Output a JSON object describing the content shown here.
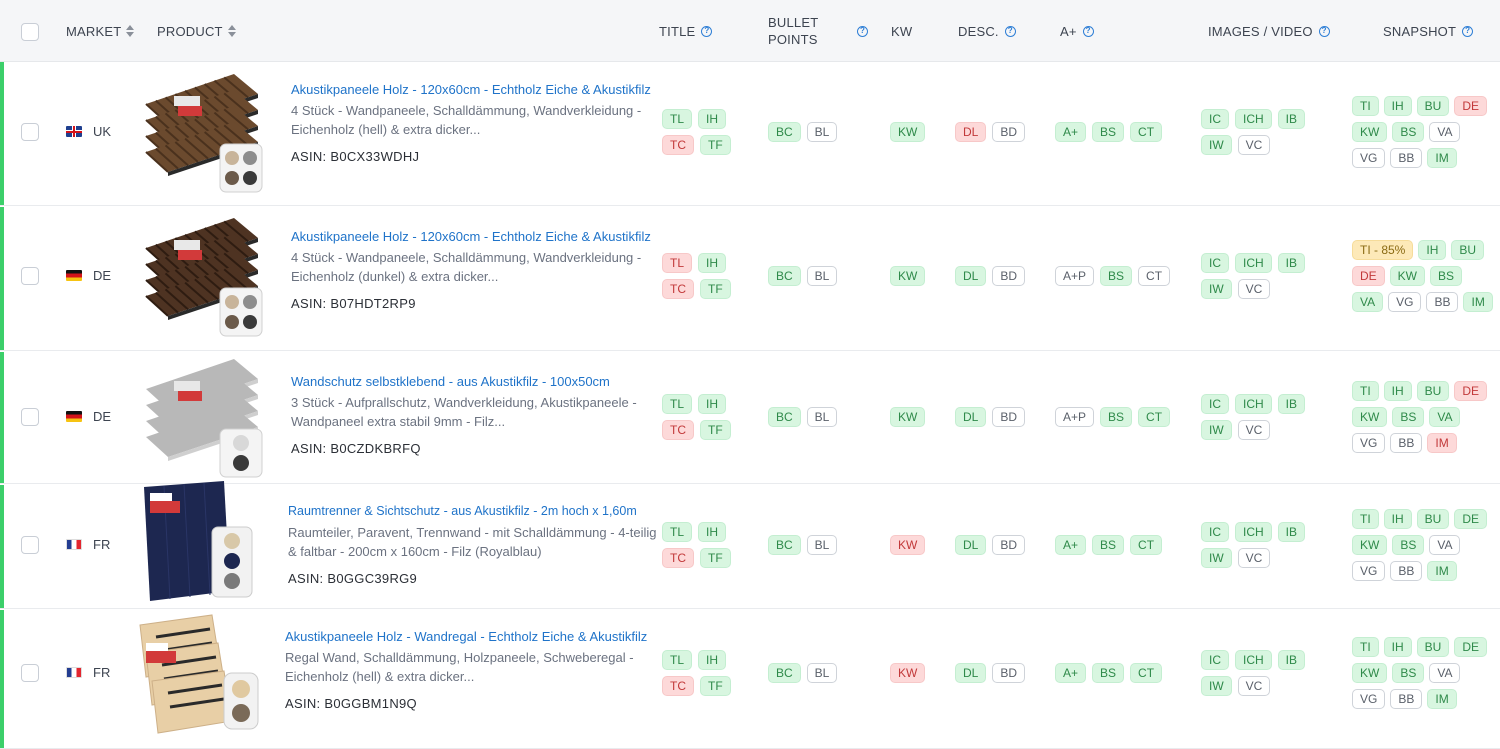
{
  "header": {
    "market": "MARKET",
    "product": "PRODUCT",
    "title": "TITLE",
    "bullet_line1": "BULLET",
    "bullet_line2": "POINTS",
    "kw": "KW",
    "desc": "DESC.",
    "aplus": "A+",
    "images": "IMAGES / VIDEO",
    "snapshot": "SNAPSHOT",
    "help_glyph": "?"
  },
  "rows": [
    {
      "market": "UK",
      "flag": "uk",
      "title": "Akustikpaneele Holz - 120x60cm - Echtholz Eiche & Akustikfilz",
      "description": "4 Stück - Wandpaneele, Schalldämmung, Wandverkleidung - Eichenholz (hell) & extra dicker...",
      "asin": "ASIN: B0CX33WDHJ",
      "image_style": "oak-light",
      "title_tags": [
        {
          "l": "TL",
          "s": "g"
        },
        {
          "l": "IH",
          "s": "g"
        },
        {
          "l": "TC",
          "s": "r"
        },
        {
          "l": "TF",
          "s": "g"
        }
      ],
      "bullet_tags": [
        {
          "l": "BC",
          "s": "g"
        },
        {
          "l": "BL",
          "s": "w"
        }
      ],
      "kw_tags": [
        {
          "l": "KW",
          "s": "g"
        }
      ],
      "desc_tags": [
        {
          "l": "DL",
          "s": "r"
        },
        {
          "l": "BD",
          "s": "w"
        }
      ],
      "aplus_tags": [
        {
          "l": "A+",
          "s": "g"
        },
        {
          "l": "BS",
          "s": "g"
        },
        {
          "l": "CT",
          "s": "g"
        }
      ],
      "image_tags": [
        {
          "l": "IC",
          "s": "g"
        },
        {
          "l": "ICH",
          "s": "g"
        },
        {
          "l": "IB",
          "s": "g"
        },
        {
          "l": "IW",
          "s": "g"
        },
        {
          "l": "VC",
          "s": "w"
        }
      ],
      "snapshot_tags": [
        {
          "l": "TI",
          "s": "g"
        },
        {
          "l": "IH",
          "s": "g"
        },
        {
          "l": "BU",
          "s": "g"
        },
        {
          "l": "DE",
          "s": "r"
        },
        {
          "l": "KW",
          "s": "g"
        },
        {
          "l": "BS",
          "s": "g"
        },
        {
          "l": "VA",
          "s": "w"
        },
        {
          "l": "VG",
          "s": "w"
        },
        {
          "l": "BB",
          "s": "w"
        },
        {
          "l": "IM",
          "s": "g"
        }
      ]
    },
    {
      "market": "DE",
      "flag": "de",
      "title": "Akustikpaneele Holz - 120x60cm - Echtholz Eiche & Akustikfilz",
      "description": "4 Stück - Wandpaneele, Schalldämmung, Wandverkleidung - Eichenholz (dunkel) & extra dicker...",
      "asin": "ASIN: B07HDT2RP9",
      "image_style": "oak-dark",
      "title_tags": [
        {
          "l": "TL",
          "s": "r"
        },
        {
          "l": "IH",
          "s": "g"
        },
        {
          "l": "TC",
          "s": "r"
        },
        {
          "l": "TF",
          "s": "g"
        }
      ],
      "bullet_tags": [
        {
          "l": "BC",
          "s": "g"
        },
        {
          "l": "BL",
          "s": "w"
        }
      ],
      "kw_tags": [
        {
          "l": "KW",
          "s": "g"
        }
      ],
      "desc_tags": [
        {
          "l": "DL",
          "s": "g"
        },
        {
          "l": "BD",
          "s": "w"
        }
      ],
      "aplus_tags": [
        {
          "l": "A+P",
          "s": "w"
        },
        {
          "l": "BS",
          "s": "g"
        },
        {
          "l": "CT",
          "s": "w"
        }
      ],
      "image_tags": [
        {
          "l": "IC",
          "s": "g"
        },
        {
          "l": "ICH",
          "s": "g"
        },
        {
          "l": "IB",
          "s": "g"
        },
        {
          "l": "IW",
          "s": "g"
        },
        {
          "l": "VC",
          "s": "w"
        }
      ],
      "snapshot_tags": [
        {
          "l": "TI - 85%",
          "s": "y"
        },
        {
          "l": "IH",
          "s": "g"
        },
        {
          "l": "BU",
          "s": "g"
        },
        {
          "l": "DE",
          "s": "r"
        },
        {
          "l": "KW",
          "s": "g"
        },
        {
          "l": "BS",
          "s": "g"
        },
        {
          "l": "VA",
          "s": "g"
        },
        {
          "l": "VG",
          "s": "w"
        },
        {
          "l": "BB",
          "s": "w"
        },
        {
          "l": "IM",
          "s": "g"
        }
      ]
    },
    {
      "market": "DE",
      "flag": "de",
      "title": "Wandschutz selbstklebend - aus Akustikfilz - 100x50cm",
      "description": "3 Stück - Aufprallschutz, Wandverkleidung, Akustikpaneele - Wandpaneel extra stabil 9mm - Filz...",
      "asin": "ASIN: B0CZDKBRFQ",
      "image_style": "felt-grey",
      "title_tags": [
        {
          "l": "TL",
          "s": "g"
        },
        {
          "l": "IH",
          "s": "g"
        },
        {
          "l": "TC",
          "s": "r"
        },
        {
          "l": "TF",
          "s": "g"
        }
      ],
      "bullet_tags": [
        {
          "l": "BC",
          "s": "g"
        },
        {
          "l": "BL",
          "s": "w"
        }
      ],
      "kw_tags": [
        {
          "l": "KW",
          "s": "g"
        }
      ],
      "desc_tags": [
        {
          "l": "DL",
          "s": "g"
        },
        {
          "l": "BD",
          "s": "w"
        }
      ],
      "aplus_tags": [
        {
          "l": "A+P",
          "s": "w"
        },
        {
          "l": "BS",
          "s": "g"
        },
        {
          "l": "CT",
          "s": "g"
        }
      ],
      "image_tags": [
        {
          "l": "IC",
          "s": "g"
        },
        {
          "l": "ICH",
          "s": "g"
        },
        {
          "l": "IB",
          "s": "g"
        },
        {
          "l": "IW",
          "s": "g"
        },
        {
          "l": "VC",
          "s": "w"
        }
      ],
      "snapshot_tags": [
        {
          "l": "TI",
          "s": "g"
        },
        {
          "l": "IH",
          "s": "g"
        },
        {
          "l": "BU",
          "s": "g"
        },
        {
          "l": "DE",
          "s": "r"
        },
        {
          "l": "KW",
          "s": "g"
        },
        {
          "l": "BS",
          "s": "g"
        },
        {
          "l": "VA",
          "s": "g"
        },
        {
          "l": "VG",
          "s": "w"
        },
        {
          "l": "BB",
          "s": "w"
        },
        {
          "l": "IM",
          "s": "r"
        }
      ]
    },
    {
      "market": "FR",
      "flag": "fr",
      "title": "Raumtrenner & Sichtschutz - aus Akustikfilz - 2m hoch x 1,60m",
      "description": "Raumteiler, Paravent, Trennwand - mit Schalldämmung - 4-teilig & faltbar - 200cm x 160cm - Filz (Royalblau)",
      "asin": "ASIN: B0GGC39RG9",
      "image_style": "divider-blue",
      "title_tags": [
        {
          "l": "TL",
          "s": "g"
        },
        {
          "l": "IH",
          "s": "g"
        },
        {
          "l": "TC",
          "s": "r"
        },
        {
          "l": "TF",
          "s": "g"
        }
      ],
      "bullet_tags": [
        {
          "l": "BC",
          "s": "g"
        },
        {
          "l": "BL",
          "s": "w"
        }
      ],
      "kw_tags": [
        {
          "l": "KW",
          "s": "r"
        }
      ],
      "desc_tags": [
        {
          "l": "DL",
          "s": "g"
        },
        {
          "l": "BD",
          "s": "w"
        }
      ],
      "aplus_tags": [
        {
          "l": "A+",
          "s": "g"
        },
        {
          "l": "BS",
          "s": "g"
        },
        {
          "l": "CT",
          "s": "g"
        }
      ],
      "image_tags": [
        {
          "l": "IC",
          "s": "g"
        },
        {
          "l": "ICH",
          "s": "g"
        },
        {
          "l": "IB",
          "s": "g"
        },
        {
          "l": "IW",
          "s": "g"
        },
        {
          "l": "VC",
          "s": "w"
        }
      ],
      "snapshot_tags": [
        {
          "l": "TI",
          "s": "g"
        },
        {
          "l": "IH",
          "s": "g"
        },
        {
          "l": "BU",
          "s": "g"
        },
        {
          "l": "DE",
          "s": "g"
        },
        {
          "l": "KW",
          "s": "g"
        },
        {
          "l": "BS",
          "s": "g"
        },
        {
          "l": "VA",
          "s": "w"
        },
        {
          "l": "VG",
          "s": "w"
        },
        {
          "l": "BB",
          "s": "w"
        },
        {
          "l": "IM",
          "s": "g"
        }
      ]
    },
    {
      "market": "FR",
      "flag": "fr",
      "title": "Akustikpaneele Holz - Wandregal - Echtholz Eiche & Akustikfilz",
      "description": "Regal Wand, Schalldämmung, Holzpaneele, Schweberegal - Eichenholz (hell) & extra dicker...",
      "asin": "ASIN: B0GGBM1N9Q",
      "image_style": "shelf-oak",
      "title_tags": [
        {
          "l": "TL",
          "s": "g"
        },
        {
          "l": "IH",
          "s": "g"
        },
        {
          "l": "TC",
          "s": "r"
        },
        {
          "l": "TF",
          "s": "g"
        }
      ],
      "bullet_tags": [
        {
          "l": "BC",
          "s": "g"
        },
        {
          "l": "BL",
          "s": "w"
        }
      ],
      "kw_tags": [
        {
          "l": "KW",
          "s": "r"
        }
      ],
      "desc_tags": [
        {
          "l": "DL",
          "s": "g"
        },
        {
          "l": "BD",
          "s": "w"
        }
      ],
      "aplus_tags": [
        {
          "l": "A+",
          "s": "g"
        },
        {
          "l": "BS",
          "s": "g"
        },
        {
          "l": "CT",
          "s": "g"
        }
      ],
      "image_tags": [
        {
          "l": "IC",
          "s": "g"
        },
        {
          "l": "ICH",
          "s": "g"
        },
        {
          "l": "IB",
          "s": "g"
        },
        {
          "l": "IW",
          "s": "g"
        },
        {
          "l": "VC",
          "s": "w"
        }
      ],
      "snapshot_tags": [
        {
          "l": "TI",
          "s": "g"
        },
        {
          "l": "IH",
          "s": "g"
        },
        {
          "l": "BU",
          "s": "g"
        },
        {
          "l": "DE",
          "s": "g"
        },
        {
          "l": "KW",
          "s": "g"
        },
        {
          "l": "BS",
          "s": "g"
        },
        {
          "l": "VA",
          "s": "w"
        },
        {
          "l": "VG",
          "s": "w"
        },
        {
          "l": "BB",
          "s": "w"
        },
        {
          "l": "IM",
          "s": "g"
        }
      ]
    }
  ]
}
